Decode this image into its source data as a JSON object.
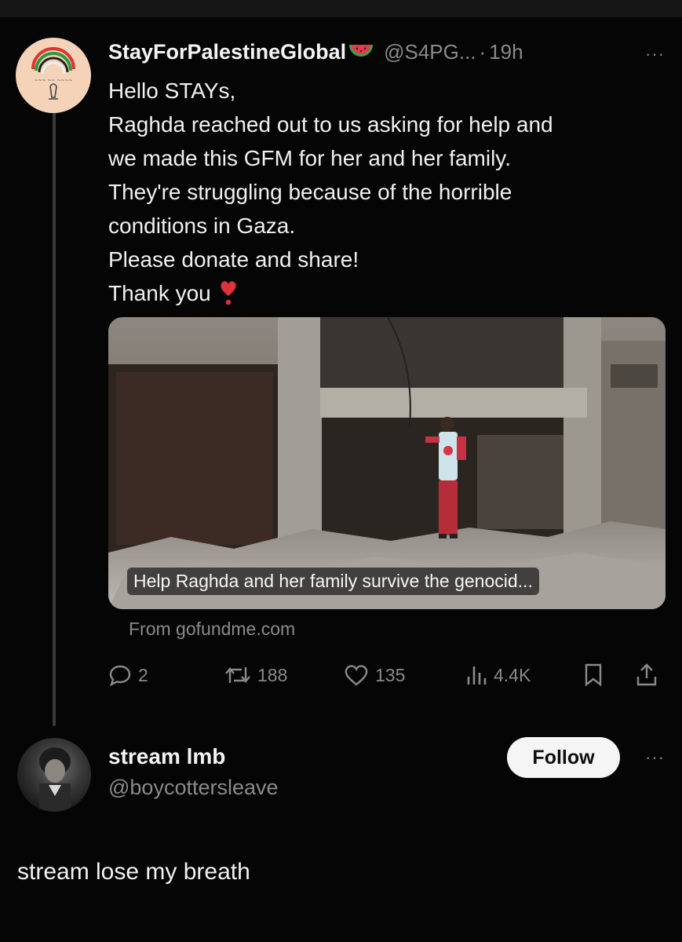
{
  "post": {
    "author_name": "StayForPalestineGlobal",
    "author_emoji": "watermelon-icon",
    "handle": "@S4PG...",
    "separator": "·",
    "time": "19h",
    "more": "···",
    "lines": [
      "Hello STAYs,",
      "Raghda reached out to us asking for help and",
      "we made this GFM for her and her family.",
      "They're struggling because of the horrible",
      "conditions in Gaza.",
      "Please donate and share!",
      "Thank you"
    ],
    "link_card": {
      "caption": "Help Raghda and her family survive the genocid...",
      "source": "From gofundme.com"
    },
    "actions": {
      "replies": "2",
      "reposts": "188",
      "likes": "135",
      "views": "4.4K"
    },
    "colors": {
      "background": "#050505",
      "muted": "#8a8a8a",
      "heart": "#e0323c"
    }
  },
  "reply": {
    "author_name": "stream lmb",
    "handle": "@boycottersleave",
    "follow_label": "Follow",
    "more": "···",
    "text": "stream lose my breath"
  }
}
